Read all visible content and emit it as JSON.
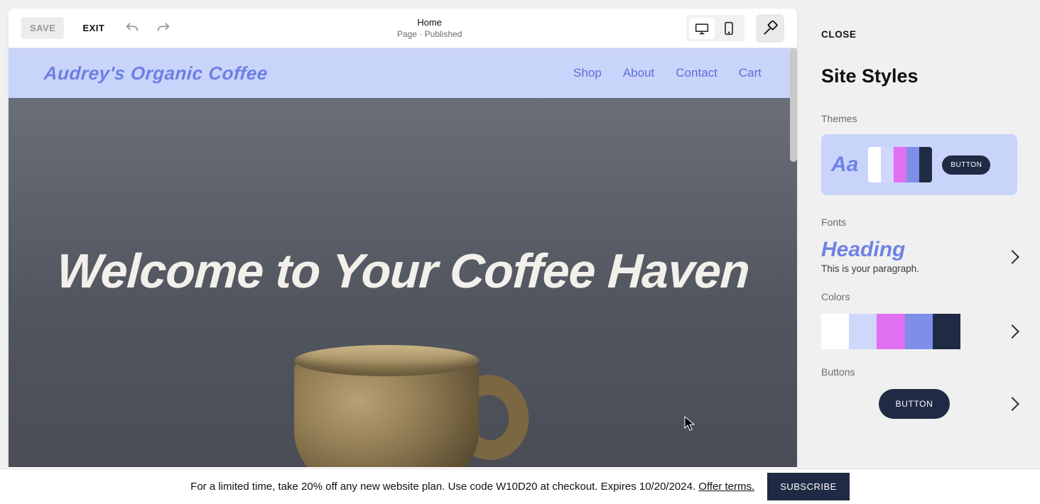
{
  "toolbar": {
    "save": "SAVE",
    "exit": "EXIT",
    "title": "Home",
    "subtitle": "Page · Published"
  },
  "site": {
    "brand": "Audrey's Organic Coffee",
    "nav": {
      "shop": "Shop",
      "about": "About",
      "contact": "Contact",
      "cart": "Cart"
    },
    "hero_title": "Welcome to Your Coffee Haven"
  },
  "panel": {
    "close": "CLOSE",
    "title": "Site Styles",
    "themes_label": "Themes",
    "theme_sample": "Aa",
    "theme_button": "BUTTON",
    "fonts_label": "Fonts",
    "fonts_heading": "Heading",
    "fonts_para": "This is your paragraph.",
    "colors_label": "Colors",
    "buttons_label": "Buttons",
    "buttons_sample": "BUTTON"
  },
  "palette": {
    "c1": "#ffffff",
    "c2": "#cfd7fb",
    "c3": "#e170f0",
    "c4": "#7d8fe8",
    "c5": "#1f2a44"
  },
  "promo": {
    "text": "For a limited time, take 20% off any new website plan. Use code W10D20 at checkout. Expires 10/20/2024. ",
    "offer": "Offer terms.",
    "subscribe": "SUBSCRIBE"
  }
}
